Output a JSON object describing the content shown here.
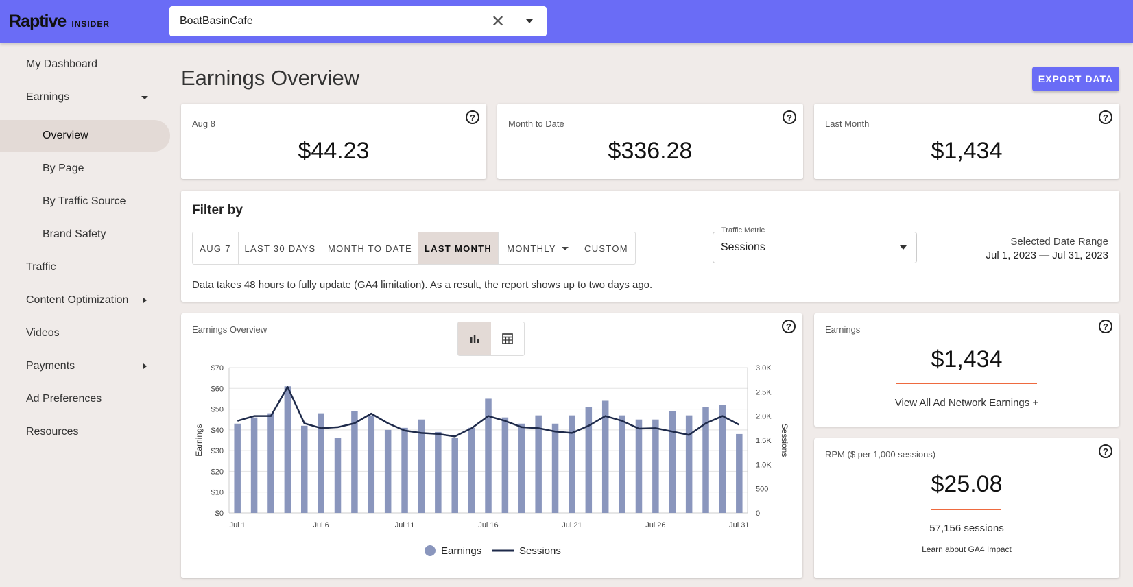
{
  "brand": {
    "name": "Raptive",
    "sub": "INSIDER"
  },
  "site_selector": {
    "value": "BoatBasinCafe"
  },
  "sidebar": {
    "items": [
      {
        "label": "My Dashboard"
      },
      {
        "label": "Earnings"
      },
      {
        "label": "Overview"
      },
      {
        "label": "By Page"
      },
      {
        "label": "By Traffic Source"
      },
      {
        "label": "Brand Safety"
      },
      {
        "label": "Traffic"
      },
      {
        "label": "Content Optimization"
      },
      {
        "label": "Videos"
      },
      {
        "label": "Payments"
      },
      {
        "label": "Ad Preferences"
      },
      {
        "label": "Resources"
      }
    ]
  },
  "header": {
    "title": "Earnings Overview",
    "export_label": "EXPORT DATA"
  },
  "summary_cards": [
    {
      "label": "Aug 8",
      "value": "$44.23"
    },
    {
      "label": "Month to Date",
      "value": "$336.28"
    },
    {
      "label": "Last Month",
      "value": "$1,434"
    }
  ],
  "filter": {
    "title": "Filter by",
    "options": [
      "AUG 7",
      "LAST 30 DAYS",
      "MONTH TO DATE",
      "LAST MONTH",
      "MONTHLY",
      "CUSTOM"
    ],
    "selected": "LAST MONTH",
    "metric_label": "Traffic Metric",
    "metric_value": "Sessions",
    "range_label": "Selected Date Range",
    "range_value": "Jul 1, 2023 — Jul 31, 2023",
    "note": "Data takes 48 hours to fully update (GA4 limitation). As a result, the report shows up to two days ago."
  },
  "chart_card": {
    "title": "Earnings Overview"
  },
  "chart_data": {
    "type": "bar",
    "categories": [
      "Jul 1",
      "Jul 2",
      "Jul 3",
      "Jul 4",
      "Jul 5",
      "Jul 6",
      "Jul 7",
      "Jul 8",
      "Jul 9",
      "Jul 10",
      "Jul 11",
      "Jul 12",
      "Jul 13",
      "Jul 14",
      "Jul 15",
      "Jul 16",
      "Jul 17",
      "Jul 18",
      "Jul 19",
      "Jul 20",
      "Jul 21",
      "Jul 22",
      "Jul 23",
      "Jul 24",
      "Jul 25",
      "Jul 26",
      "Jul 27",
      "Jul 28",
      "Jul 29",
      "Jul 30",
      "Jul 31"
    ],
    "x_tick_labels": [
      "Jul 1",
      "Jul 6",
      "Jul 11",
      "Jul 16",
      "Jul 21",
      "Jul 26",
      "Jul 31"
    ],
    "series": [
      {
        "name": "Earnings",
        "type": "bar",
        "axis": "left",
        "color": "#8a96bd",
        "values": [
          43,
          46,
          48,
          61,
          42,
          48,
          36,
          49,
          47,
          40,
          41,
          45,
          39,
          36,
          41,
          55,
          46,
          43,
          47,
          43,
          47,
          51,
          54,
          47,
          45,
          45,
          49,
          47,
          51,
          52,
          38
        ]
      },
      {
        "name": "Sessions",
        "type": "line",
        "axis": "right",
        "color": "#1e2a4a",
        "values": [
          1900,
          2000,
          2000,
          2600,
          1850,
          1750,
          1770,
          1850,
          2050,
          1850,
          1700,
          1650,
          1630,
          1580,
          1750,
          2000,
          1900,
          1770,
          1750,
          1680,
          1650,
          1800,
          2000,
          1900,
          1740,
          1750,
          1680,
          1610,
          1850,
          2000,
          1820
        ]
      }
    ],
    "ylabel": "Earnings",
    "y2label": "Sessions",
    "ylim": [
      0,
      70
    ],
    "y2lim": [
      0,
      3000
    ],
    "y_ticks": [
      "$0",
      "$10",
      "$20",
      "$30",
      "$40",
      "$50",
      "$60",
      "$70"
    ],
    "y2_ticks": [
      "0",
      "500",
      "1.0K",
      "1.5K",
      "2.0K",
      "2.5K",
      "3.0K"
    ],
    "grid": true,
    "legend": "bottom-center"
  },
  "earnings_card": {
    "label": "Earnings",
    "value": "$1,434",
    "link": "View All Ad Network Earnings +"
  },
  "rpm_card": {
    "label": "RPM ($ per 1,000 sessions)",
    "value": "$25.08",
    "sessions": "57,156 sessions",
    "link": "Learn about GA4 Impact"
  },
  "colors": {
    "accent": "#6a6cf6",
    "bar": "#8a96bd",
    "line": "#1e2a4a",
    "underline": "#ee6a3f",
    "selected_bg": "#e3dad6"
  }
}
